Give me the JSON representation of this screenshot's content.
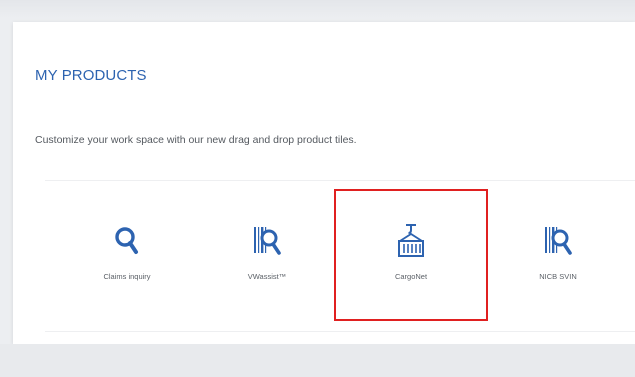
{
  "section": {
    "title": "MY PRODUCTS",
    "description": "Customize your work space with our new drag and drop product tiles."
  },
  "products": [
    {
      "label": "Claims inquiry",
      "icon": "search-icon"
    },
    {
      "label": "VWassist™",
      "icon": "barcode-search-icon"
    },
    {
      "label": "CargoNet",
      "icon": "cargo-container-icon",
      "highlighted": true
    },
    {
      "label": "NICB SVIN",
      "icon": "barcode-search-icon"
    }
  ],
  "colors": {
    "accent": "#2d63b0",
    "highlight": "#e02020",
    "text": "#555a60"
  }
}
